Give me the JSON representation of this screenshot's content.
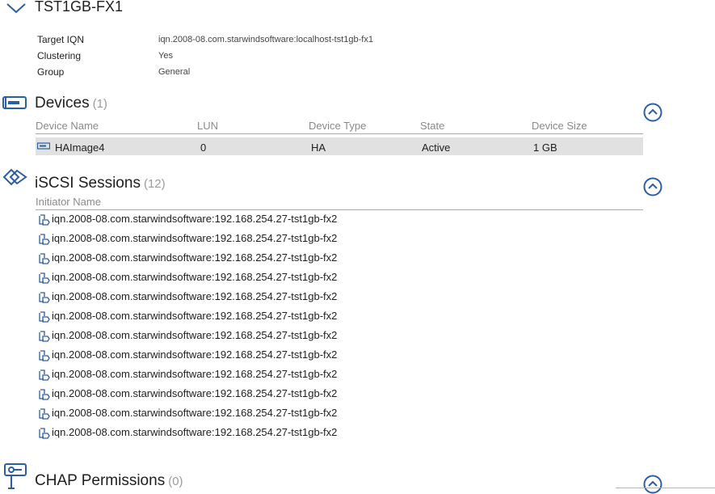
{
  "target": {
    "name": "TST1GB-FX1",
    "properties": [
      {
        "label": "Target IQN",
        "value": "iqn.2008-08.com.starwindsoftware:localhost-tst1gb-fx1"
      },
      {
        "label": "Clustering",
        "value": "Yes"
      },
      {
        "label": "Group",
        "value": "General"
      }
    ]
  },
  "devices": {
    "title": "Devices",
    "count": "(1)",
    "columns": [
      "Device Name",
      "LUN",
      "Device Type",
      "State",
      "Device Size"
    ],
    "rows": [
      {
        "name": "HAImage4",
        "lun": "0",
        "type": "HA",
        "state": "Active",
        "size": "1 GB"
      }
    ]
  },
  "sessions": {
    "title": "iSCSI Sessions",
    "count": "(12)",
    "column": "Initiator Name",
    "items": [
      "iqn.2008-08.com.starwindsoftware:192.168.254.27-tst1gb-fx2",
      "iqn.2008-08.com.starwindsoftware:192.168.254.27-tst1gb-fx2",
      "iqn.2008-08.com.starwindsoftware:192.168.254.27-tst1gb-fx2",
      "iqn.2008-08.com.starwindsoftware:192.168.254.27-tst1gb-fx2",
      "iqn.2008-08.com.starwindsoftware:192.168.254.27-tst1gb-fx2",
      "iqn.2008-08.com.starwindsoftware:192.168.254.27-tst1gb-fx2",
      "iqn.2008-08.com.starwindsoftware:192.168.254.27-tst1gb-fx2",
      "iqn.2008-08.com.starwindsoftware:192.168.254.27-tst1gb-fx2",
      "iqn.2008-08.com.starwindsoftware:192.168.254.27-tst1gb-fx2",
      "iqn.2008-08.com.starwindsoftware:192.168.254.27-tst1gb-fx2",
      "iqn.2008-08.com.starwindsoftware:192.168.254.27-tst1gb-fx2",
      "iqn.2008-08.com.starwindsoftware:192.168.254.27-tst1gb-fx2"
    ]
  },
  "chap": {
    "title": "CHAP Permissions",
    "count": "(0)"
  },
  "icons": {
    "target_toggle": "chevron-down-icon",
    "devices": "device-icon",
    "sessions": "iscsi-session-icon",
    "session_item": "session-link-icon",
    "chap": "key-icon",
    "collapse": "chevron-up-circle-icon"
  },
  "colors": {
    "accent": "#2c5ea3",
    "selected_row": "#e1e1e1",
    "muted_text": "#8a8a8a"
  }
}
